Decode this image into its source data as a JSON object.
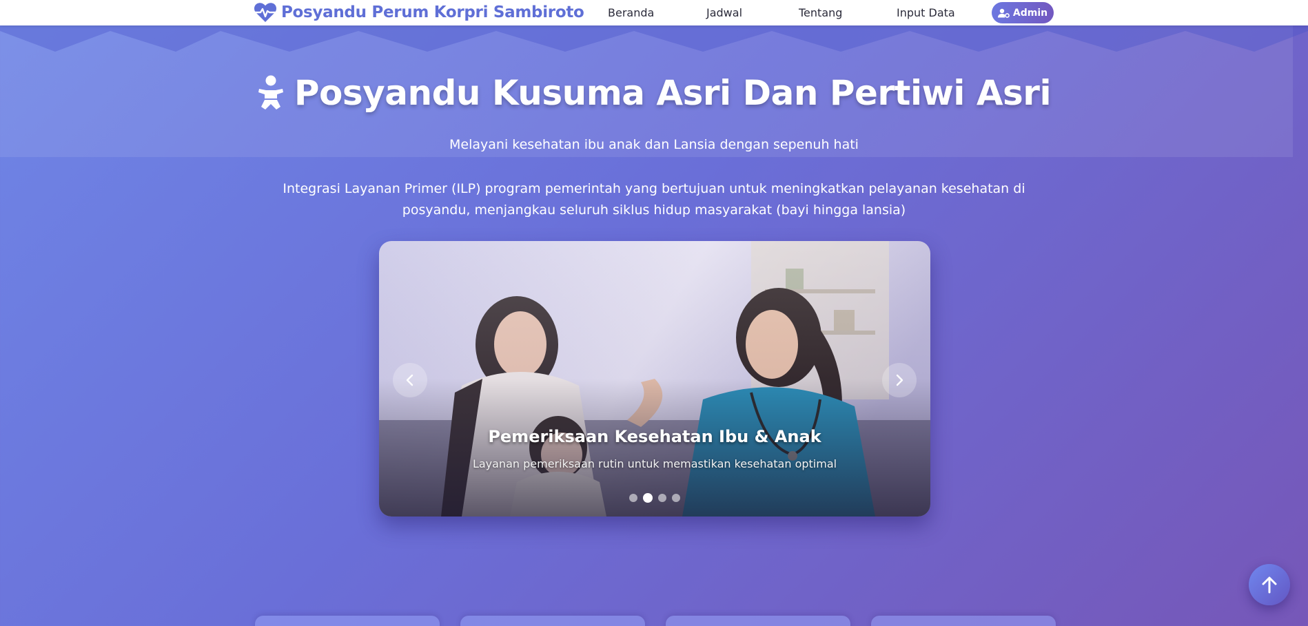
{
  "navbar": {
    "brand": "Posyandu Perum Korpri Sambiroto",
    "links": [
      "Beranda",
      "Jadwal",
      "Tentang",
      "Input Data"
    ],
    "admin_label": "Admin"
  },
  "hero": {
    "title": "Posyandu Kusuma Asri Dan Pertiwi Asri",
    "subtitle": "Melayani kesehatan ibu anak dan Lansia dengan sepenuh hati",
    "description": "Integrasi Layanan Primer (ILP) program pemerintah yang bertujuan untuk meningkatkan pelayanan kesehatan di posyandu, menjangkau seluruh siklus hidup masyarakat (bayi hingga lansia)"
  },
  "carousel": {
    "slide_title": "Pemeriksaan Kesehatan Ibu & Anak",
    "slide_caption": "Layanan pemeriksaan rutin untuk memastikan kesehatan optimal",
    "slide_count": 4,
    "active_index": 1
  },
  "colors": {
    "brand": "#5f6fd6",
    "gradient_start": "#6f86e6",
    "gradient_end": "#7657b8",
    "admin_button": "#6c77e0"
  },
  "icons": {
    "brand": "heartbeat-icon",
    "hero": "baby-icon",
    "admin": "user-gear-icon",
    "prev": "chevron-left-icon",
    "next": "chevron-right-icon",
    "back_to_top": "arrow-up-icon"
  }
}
